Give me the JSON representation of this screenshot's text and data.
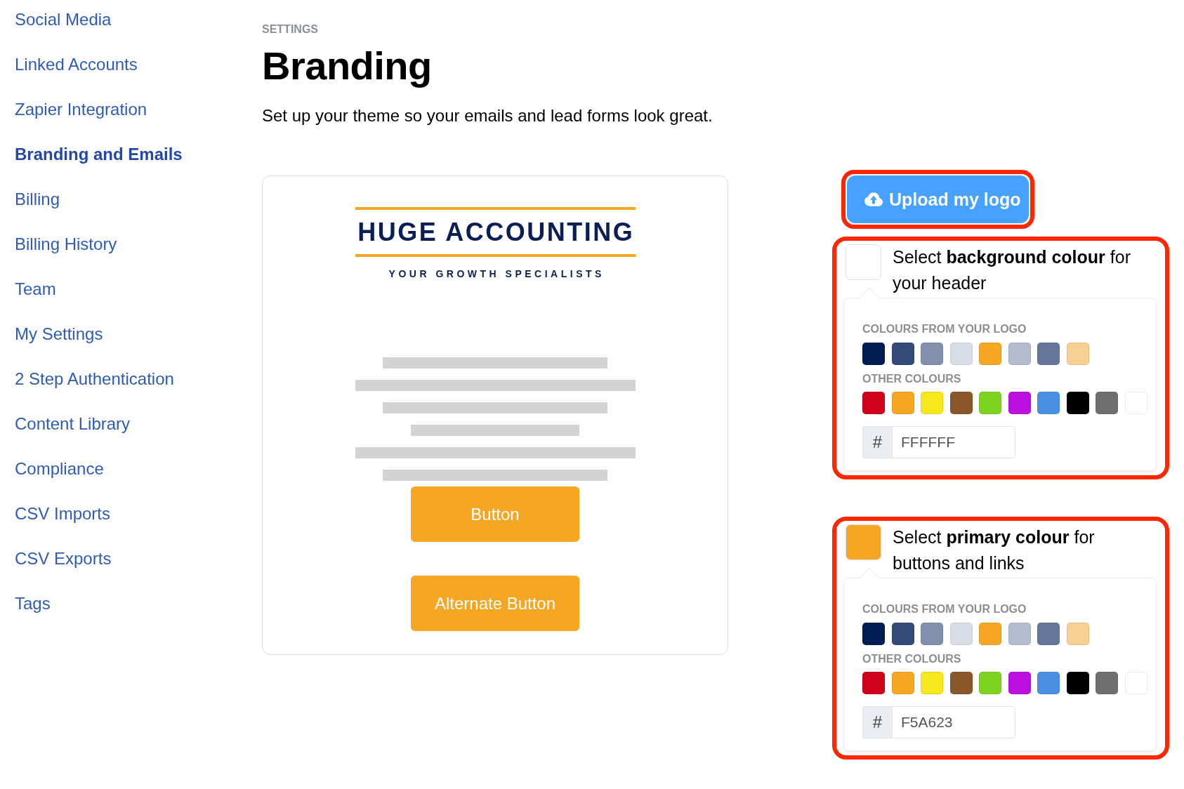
{
  "sidebar": {
    "items": [
      {
        "label": "Social Media",
        "selected": false
      },
      {
        "label": "Linked Accounts",
        "selected": false
      },
      {
        "label": "Zapier Integration",
        "selected": false
      },
      {
        "label": "Branding and Emails",
        "selected": true
      },
      {
        "label": "Billing",
        "selected": false
      },
      {
        "label": "Billing History",
        "selected": false
      },
      {
        "label": "Team",
        "selected": false
      },
      {
        "label": "My Settings",
        "selected": false
      },
      {
        "label": "2 Step Authentication",
        "selected": false
      },
      {
        "label": "Content Library",
        "selected": false
      },
      {
        "label": "Compliance",
        "selected": false
      },
      {
        "label": "CSV Imports",
        "selected": false
      },
      {
        "label": "CSV Exports",
        "selected": false
      },
      {
        "label": "Tags",
        "selected": false
      }
    ]
  },
  "header": {
    "section": "SETTINGS",
    "title": "Branding",
    "description": "Set up your theme so your emails and lead forms look great."
  },
  "preview": {
    "logo_name": "HUGE ACCOUNTING",
    "logo_tagline": "YOUR GROWTH SPECIALISTS",
    "buttons": [
      "Button",
      "Alternate Button"
    ]
  },
  "upload_button": {
    "label": "Upload my logo",
    "highlighted": true
  },
  "colour_pickers": [
    {
      "color": "#ffffff",
      "prompt": "Select **background colour** for your header",
      "highlighted": true,
      "logo_colours_label": "COLOURS FROM YOUR LOGO",
      "logo_colours": [
        {
          "color": "#021d53"
        },
        {
          "color": "#344a78"
        },
        {
          "color": "#8190ad"
        },
        {
          "color": "#d9dde6"
        },
        {
          "color": "#f5a623"
        },
        {
          "color": "#b3bbcf"
        },
        {
          "color": "#66769a"
        },
        {
          "color": "#f8d091"
        }
      ],
      "other_colours_label": "OTHER COLOURS",
      "other_colours": [
        {
          "color": "#d0021b"
        },
        {
          "color": "#f5a623"
        },
        {
          "color": "#f8e71c"
        },
        {
          "color": "#8b572a"
        },
        {
          "color": "#7ed321"
        },
        {
          "color": "#bd10e0"
        },
        {
          "color": "#4a90e2"
        },
        {
          "color": "#000000"
        },
        {
          "color": "#6f6f6f"
        },
        {
          "color": "#ffffff"
        }
      ],
      "hex_prefix": "#",
      "hex_value": "FFFFFF"
    },
    {
      "color": "#f5a623",
      "prompt": "Select **primary colour** for buttons and links",
      "highlighted": true,
      "logo_colours_label": "COLOURS FROM YOUR LOGO",
      "logo_colours": [
        {
          "color": "#021d53"
        },
        {
          "color": "#344a78"
        },
        {
          "color": "#8190ad"
        },
        {
          "color": "#d9dde6"
        },
        {
          "color": "#f5a623"
        },
        {
          "color": "#b3bbcf"
        },
        {
          "color": "#66769a"
        },
        {
          "color": "#f8d091"
        }
      ],
      "other_colours_label": "OTHER COLOURS",
      "other_colours": [
        {
          "color": "#d0021b"
        },
        {
          "color": "#f5a623"
        },
        {
          "color": "#f8e71c"
        },
        {
          "color": "#8b572a"
        },
        {
          "color": "#7ed321"
        },
        {
          "color": "#bd10e0"
        },
        {
          "color": "#4a90e2"
        },
        {
          "color": "#000000"
        },
        {
          "color": "#6f6f6f"
        },
        {
          "color": "#ffffff"
        }
      ],
      "hex_prefix": "#",
      "hex_value": "F5A623"
    }
  ]
}
